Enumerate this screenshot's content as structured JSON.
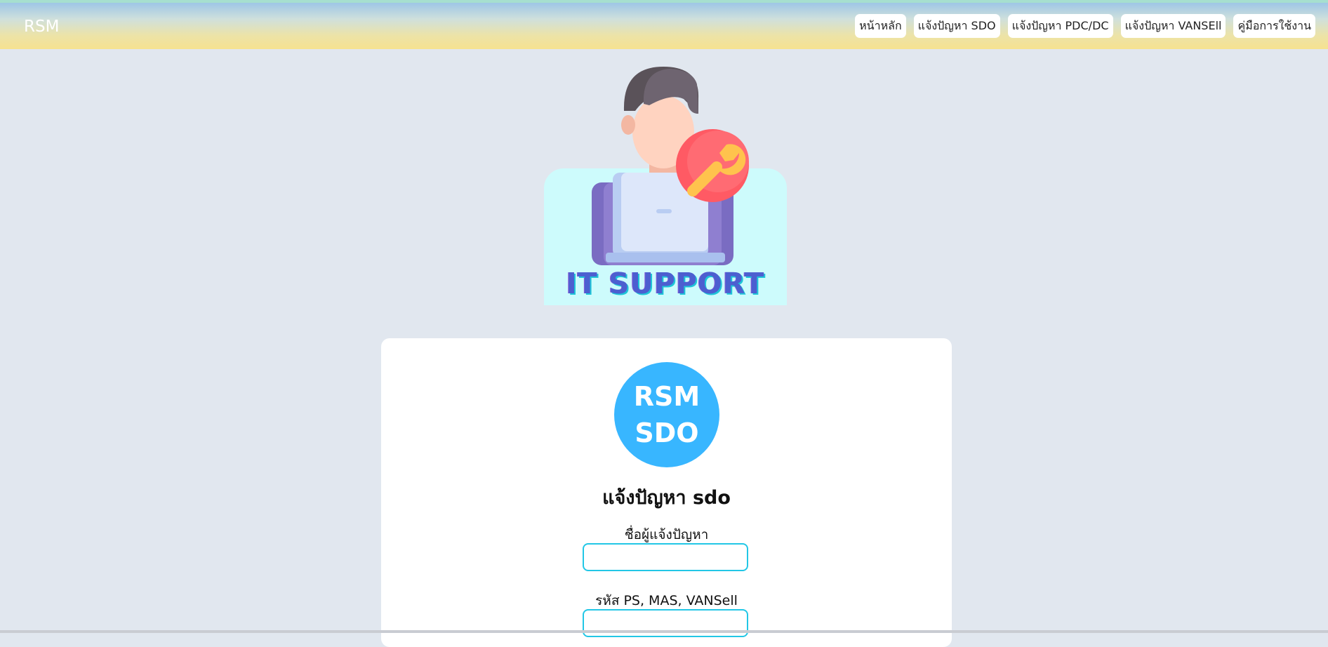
{
  "navbar": {
    "brand": "RSM",
    "links": [
      {
        "label": "หน้าหลัก"
      },
      {
        "label": "แจ้งปัญหา SDO"
      },
      {
        "label": "แจ้งปัญหา PDC/DC"
      },
      {
        "label": "แจ้งปัญหา VANSEll"
      },
      {
        "label": "คู่มือการใช้งาน"
      }
    ]
  },
  "hero": {
    "banner_text": "IT SUPPORT",
    "icons": [
      "support-person-icon",
      "wrench-badge-icon",
      "laptop-icon"
    ]
  },
  "form": {
    "logo_line1": "RSM",
    "logo_line2": "SDO",
    "title": "แจ้งปัญหา sdo",
    "fields": [
      {
        "label": "ชื่อผู้แจ้งปัญหา",
        "value": ""
      },
      {
        "label": "รหัส PS, MAS, VANSell",
        "value": ""
      }
    ]
  },
  "colors": {
    "navbar_gradient_top": "#9ec6e6",
    "navbar_gradient_bottom": "#f6e290",
    "page_background": "#e1e7ef",
    "logo_blue": "#38b6ff",
    "input_border": "#22c7e6"
  }
}
